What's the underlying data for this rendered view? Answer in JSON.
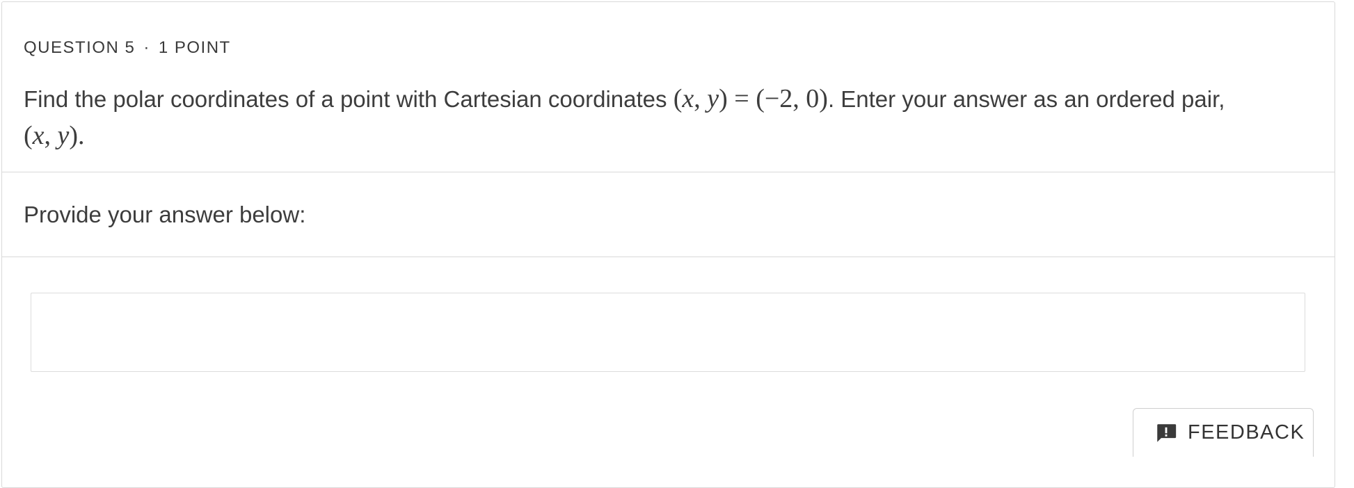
{
  "question": {
    "number_label": "QUESTION 5",
    "separator": "·",
    "points_label": "1 POINT",
    "prompt_before": "Find the polar coordinates of a point with Cartesian coordinates ",
    "prompt_math_lhs_open": "(",
    "prompt_math_x": "x",
    "prompt_math_comma": ", ",
    "prompt_math_y": "y",
    "prompt_math_rhs": ") = (−2, 0)",
    "prompt_after": ". Enter your answer as an ordered pair,",
    "answer_format_open": "(",
    "answer_format_x": "x",
    "answer_format_comma": ", ",
    "answer_format_y": "y",
    "answer_format_close": ").",
    "answer_format_period": ""
  },
  "answer": {
    "instruction": "Provide your answer below:",
    "value": "",
    "placeholder": ""
  },
  "feedback": {
    "label": "FEEDBACK",
    "icon": "feedback-icon"
  },
  "colors": {
    "text": "#3d3d3d",
    "border": "#d9d9d9",
    "icon": "#3a3a3a"
  }
}
